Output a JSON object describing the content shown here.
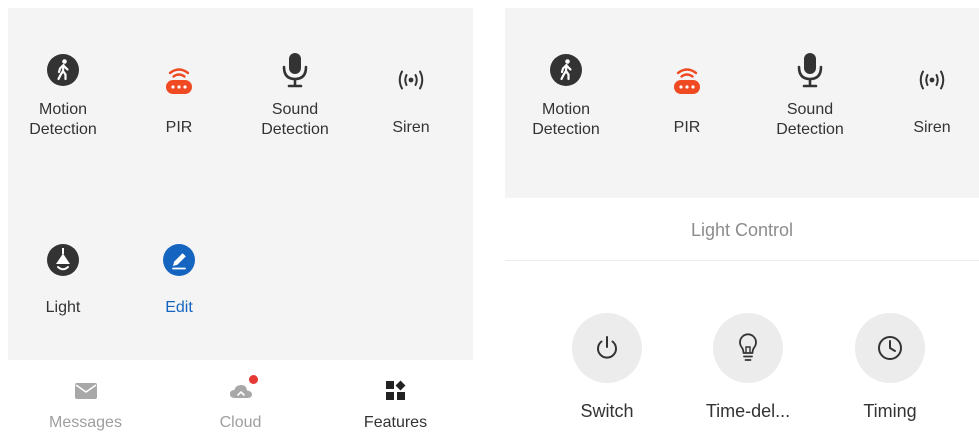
{
  "left_panel": {
    "features": [
      {
        "label": "Motion\nDetection",
        "icon": "walking-person-icon"
      },
      {
        "label": "PIR",
        "icon": "pir-sensor-icon"
      },
      {
        "label": "Sound\nDetection",
        "icon": "microphone-icon"
      },
      {
        "label": "Siren",
        "icon": "siren-icon"
      },
      {
        "label": "Light",
        "icon": "lamp-icon"
      },
      {
        "label": "Edit",
        "icon": "pencil-icon"
      }
    ],
    "nav": [
      {
        "label": "Messages",
        "icon": "envelope-icon"
      },
      {
        "label": "Cloud",
        "icon": "cloud-icon"
      },
      {
        "label": "Features",
        "icon": "grid-icon"
      }
    ]
  },
  "right_panel": {
    "features": [
      {
        "label": "Motion\nDetection"
      },
      {
        "label": "PIR"
      },
      {
        "label": "Sound\nDetection"
      },
      {
        "label": "Siren"
      }
    ],
    "light_control": {
      "title": "Light Control",
      "controls": [
        {
          "label": "Switch",
          "icon": "power-icon"
        },
        {
          "label": "Time-del...",
          "icon": "light-bulb-icon"
        },
        {
          "label": "Timing",
          "icon": "clock-icon"
        }
      ]
    }
  },
  "colors": {
    "accent_red": "#f04a23",
    "accent_blue": "#1565c0",
    "icon_dark": "#333333",
    "badge_red": "#e53935"
  }
}
